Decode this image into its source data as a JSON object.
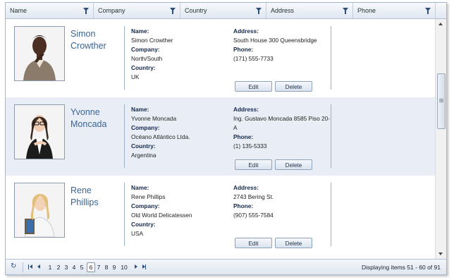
{
  "columns": [
    {
      "label": "Name"
    },
    {
      "label": "Company"
    },
    {
      "label": "Country"
    },
    {
      "label": "Address"
    },
    {
      "label": "Phone"
    }
  ],
  "labels": {
    "name": "Name:",
    "company": "Company:",
    "country": "Country:",
    "address": "Address:",
    "phone": "Phone:",
    "edit": "Edit",
    "delete": "Delete"
  },
  "records": [
    {
      "first": "Simon",
      "last": "Crowther",
      "name": "Simon Crowther",
      "company": "North/South",
      "country": "UK",
      "address": "South House 300 Queensbridge",
      "phone": "(171) 555-7733"
    },
    {
      "first": "Yvonne",
      "last": "Moncada",
      "name": "Yvonne Moncada",
      "company": "Océano Atlántico Ltda.",
      "country": "Argentina",
      "address_1": "Ing. Gustavo Moncada 8585 Piso 20-",
      "address_2": "A",
      "phone": "(1) 135-5333"
    },
    {
      "first": "Rene",
      "last": "Phillips",
      "name": "Rene Phillips",
      "company": "Old World Delicatessen",
      "country": "USA",
      "address": "2743 Bering St.",
      "phone": "(907) 555-7584"
    }
  ],
  "pager": {
    "pages": [
      "1",
      "2",
      "3",
      "4",
      "5",
      "6",
      "7",
      "8",
      "9",
      "10"
    ],
    "current": "6",
    "info": "Displaying items 51 - 60 of 91"
  },
  "icons": [
    "filter-icon",
    "refresh-icon",
    "first-page-icon",
    "prev-page-icon",
    "next-page-icon",
    "last-page-icon"
  ]
}
